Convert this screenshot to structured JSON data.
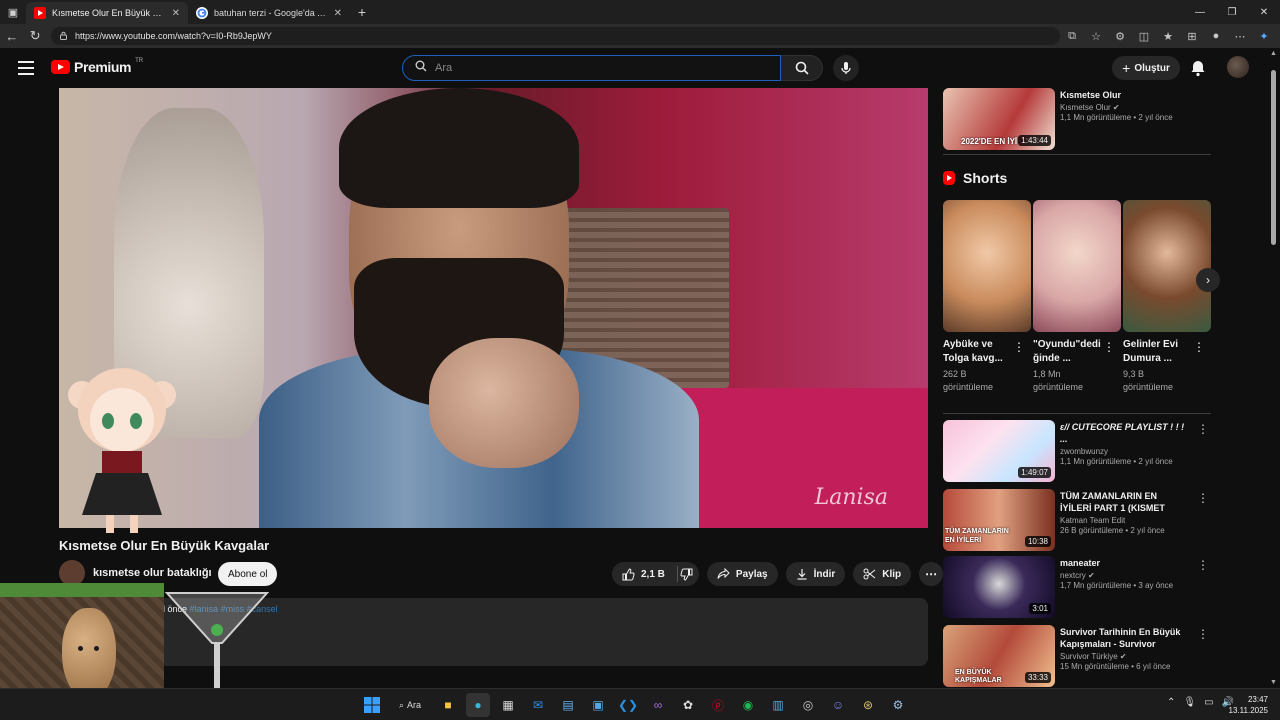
{
  "browser": {
    "tabs": [
      {
        "title": "Kısmetse Olur En Büyük Kavgalar",
        "active": true
      },
      {
        "title": "batuhan terzi - Google'da Ara",
        "active": false
      }
    ],
    "url": "https://www.youtube.com/watch?v=I0-Rb9JepWY"
  },
  "header": {
    "logo_text": "Premium",
    "logo_country": "TR",
    "search_placeholder": "Ara",
    "create_label": "Oluştur"
  },
  "video": {
    "title": "Kısmetse Olur En Büyük Kavgalar",
    "channel": "kısmetse olur bataklığı",
    "subscribe_label": "Abone ol",
    "watermark": "Lanisa",
    "likes": "2,1 B",
    "share_label": "Paylaş",
    "download_label": "İndir",
    "clip_label": "Klip",
    "desc_prefix": "l önce",
    "desc_tags": "#lanisa #miss #cansel"
  },
  "sidebar": {
    "top_rec": {
      "title": "Kısmetse Olur",
      "channel": "Kısmetse Olur",
      "stats": "1,1 Mn görüntüleme • 2 yıl önce",
      "duration": "1:43:44",
      "thumb_text": "2022'DE EN İYİ"
    },
    "shorts_title": "Shorts",
    "shorts": [
      {
        "title": "Aybüke ve Tolga kavg...",
        "views": "262 B görüntüleme"
      },
      {
        "title": "\"Oyundu\"dedi ğinde ...",
        "views": "1,8 Mn görüntüleme"
      },
      {
        "title": "Gelinler Evi Dumura ...",
        "views": "9,3 B görüntüleme"
      }
    ],
    "recs": [
      {
        "title": "ɛ// CUTECORE PLAYLIST ! ! ! ...",
        "channel": "zwombwunzy",
        "stats": "1,1 Mn görüntüleme • 2 yıl önce",
        "duration": "1:49:07"
      },
      {
        "title": "TÜM ZAMANLARIN EN İYİLERİ PART 1 (KISMET OLMAZ) ...",
        "channel": "Katman Team Edit",
        "stats": "26 B görüntüleme • 2 yıl önce",
        "duration": "10:38",
        "thumb_text": "TÜM ZAMANLARIN EN İYİLERİ"
      },
      {
        "title": "maneater",
        "channel": "nextcry",
        "stats": "1,7 Mn görüntüleme • 3 ay önce",
        "duration": "3:01"
      },
      {
        "title": "Survivor Tarihinin En Büyük Kapışmaları - Survivor Nostalji",
        "channel": "Survivor Türkiye",
        "stats": "15 Mn görüntüleme • 6 yıl önce",
        "duration": "33:33",
        "thumb_text": "EN BÜYÜK KAPIŞMALAR"
      }
    ]
  },
  "taskbar": {
    "search_label": "Ara",
    "time": "23:47",
    "date": "13.11.2025"
  },
  "colors": {
    "accent_red": "#ff0000",
    "link_blue": "#3ea6ff",
    "background": "#0f0f0f"
  }
}
